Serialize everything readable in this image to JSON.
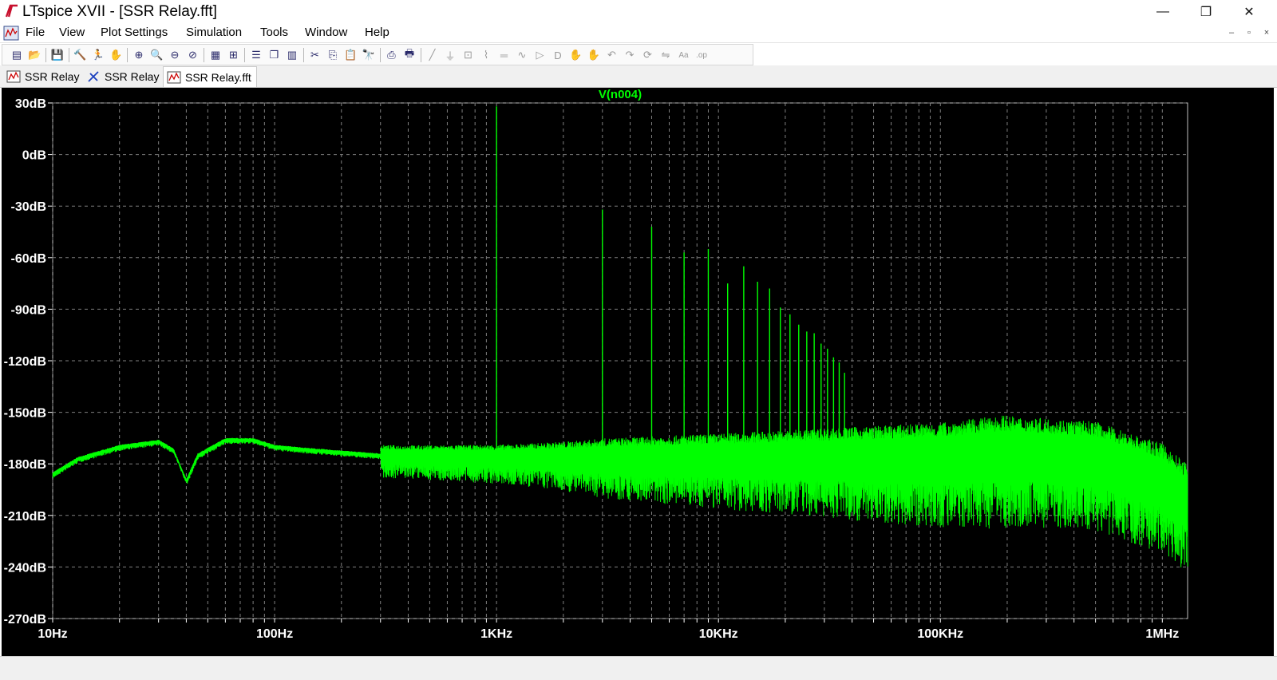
{
  "window": {
    "title": "LTspice XVII - [SSR Relay.fft]",
    "controls": [
      "—",
      "❐",
      "✕"
    ]
  },
  "menu": {
    "items": [
      "File",
      "View",
      "Plot Settings",
      "Simulation",
      "Tools",
      "Window",
      "Help"
    ],
    "mdi_controls": [
      "–",
      "▫",
      "×"
    ]
  },
  "toolbar": {
    "icons": [
      "new-schematic-icon",
      "open-icon",
      "save-icon",
      "control-panel-icon",
      "run-icon",
      "halt-icon",
      "zoom-in-icon",
      "zoom-area-icon",
      "zoom-out-icon",
      "zoom-cancel-icon",
      "autorange-icon",
      "fit-icon",
      "tile-horizontal-icon",
      "cascade-icon",
      "tile-vertical-icon",
      "cut-icon",
      "copy-icon",
      "paste-icon",
      "find-icon",
      "print-icon",
      "print-preview-icon",
      "draw-wire-icon",
      "ground-icon",
      "label-icon",
      "resistor-icon",
      "capacitor-icon",
      "inductor-icon",
      "diode-icon",
      "component-icon",
      "move-icon",
      "drag-icon",
      "undo-icon",
      "redo-icon",
      "rotate-icon",
      "mirror-icon",
      "text-icon",
      "spice-directive-icon"
    ]
  },
  "tabs": [
    {
      "label": "SSR Relay",
      "icon": "waveform-icon",
      "active": false
    },
    {
      "label": "SSR Relay",
      "icon": "schematic-icon",
      "active": false
    },
    {
      "label": "SSR Relay.fft",
      "icon": "waveform-icon",
      "active": true
    }
  ],
  "colors": {
    "trace": "#00ff00",
    "plot_background": "#000000",
    "grid": "#7f7f7f",
    "axis_text": "#ffffff"
  },
  "chart_data": {
    "type": "line",
    "title": "V(n004)",
    "xscale": "log",
    "xlim": [
      10,
      1300000
    ],
    "ylim": [
      -270,
      30
    ],
    "yticks": [
      30,
      0,
      -30,
      -60,
      -90,
      -120,
      -150,
      -180,
      -210,
      -240,
      -270
    ],
    "ytick_labels": [
      "30dB",
      "0dB",
      "-30dB",
      "-60dB",
      "-90dB",
      "-120dB",
      "-150dB",
      "-180dB",
      "-210dB",
      "-240dB",
      "-270dB"
    ],
    "xticks": [
      10,
      100,
      1000,
      10000,
      100000,
      1000000
    ],
    "xtick_labels": [
      "10Hz",
      "100Hz",
      "1KHz",
      "10KHz",
      "100KHz",
      "1MHz"
    ],
    "grid": true,
    "series": [
      {
        "name": "V(n004)",
        "baseline": [
          [
            10,
            -186
          ],
          [
            13,
            -177
          ],
          [
            20,
            -170
          ],
          [
            30,
            -167
          ],
          [
            35,
            -172
          ],
          [
            40,
            -190
          ],
          [
            45,
            -175
          ],
          [
            60,
            -166
          ],
          [
            80,
            -166
          ],
          [
            100,
            -170
          ],
          [
            150,
            -172
          ],
          [
            300,
            -175
          ],
          [
            1000,
            -176
          ],
          [
            10000,
            -176
          ],
          [
            100000,
            -175
          ],
          [
            200000,
            -172
          ],
          [
            500000,
            -175
          ],
          [
            1000000,
            -188
          ],
          [
            1300000,
            -200
          ]
        ],
        "harmonic_peaks": [
          [
            1000,
            28
          ],
          [
            3000,
            -32
          ],
          [
            5000,
            -42
          ],
          [
            7000,
            -57
          ],
          [
            9000,
            -55
          ],
          [
            11000,
            -75
          ],
          [
            13000,
            -65
          ],
          [
            15000,
            -74
          ],
          [
            17000,
            -78
          ],
          [
            19000,
            -89
          ],
          [
            21000,
            -93
          ],
          [
            23000,
            -99
          ],
          [
            25000,
            -103
          ],
          [
            27000,
            -104
          ],
          [
            29000,
            -110
          ],
          [
            31000,
            -113
          ],
          [
            33000,
            -118
          ],
          [
            35000,
            -121
          ],
          [
            37000,
            -127
          ]
        ]
      }
    ]
  }
}
